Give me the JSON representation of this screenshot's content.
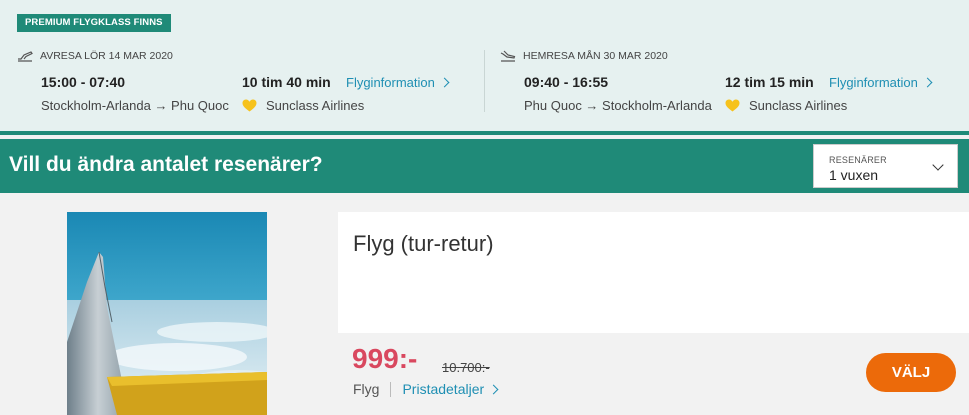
{
  "badge": "PREMIUM FLYGKLASS FINNS",
  "outbound": {
    "header": "AVRESA LÖR 14 MAR 2020",
    "times": "15:00 - 07:40",
    "route": "Stockholm-Arlanda → Phu Quoc",
    "duration": "10 tim 40 min",
    "info_link": "Flyginformation",
    "airline": "Sunclass Airlines"
  },
  "return": {
    "header": "HEMRESA MÅN 30 MAR 2020",
    "times": "09:40 - 16:55",
    "route": "Phu Quoc → Stockholm-Arlanda",
    "duration": "12 tim 15 min",
    "info_link": "Flyginformation",
    "airline": "Sunclass Airlines"
  },
  "banner": {
    "title": "Vill du ändra antalet resenärer?",
    "travellers_label": "RESENÄRER",
    "travellers_value": "1 vuxen"
  },
  "product": {
    "title": "Flyg (tur-retur)",
    "price": "999:-",
    "old_price": "10.700:-",
    "category": "Flyg",
    "price_details_link": "Pristadetaljer",
    "choose_button": "VÄLJ"
  },
  "icons": {
    "departure": "plane-takeoff-icon",
    "arrival": "plane-landing-icon",
    "airline_logo": "sunclass-heart-icon",
    "chevron": "chevron-right-icon",
    "dropdown": "chevron-down-icon"
  },
  "colors": {
    "brand_teal": "#1f8a78",
    "panel_bg": "#e6f1f0",
    "link_blue": "#1f8fb3",
    "price_red": "#d9485f",
    "cta_orange": "#ec6a0a",
    "logo_yellow": "#f6c21c"
  }
}
